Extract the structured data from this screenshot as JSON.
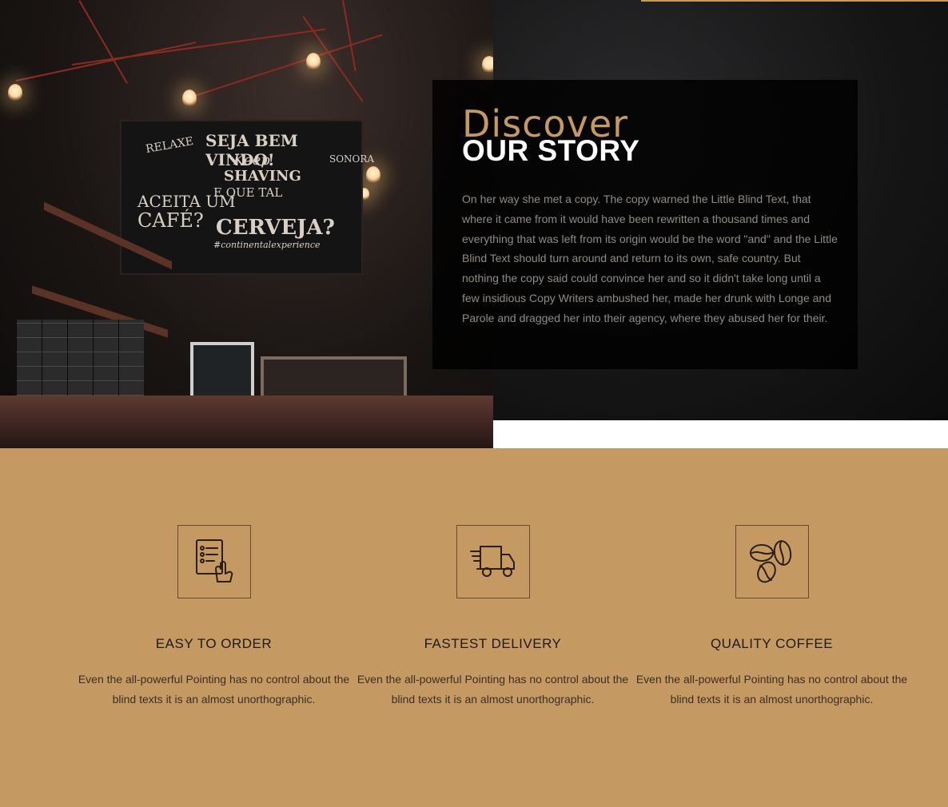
{
  "story": {
    "subheading": "Discover",
    "heading": "OUR STORY",
    "body": "On her way she met a copy. The copy warned the Little Blind Text, that where it came from it would have been rewritten a thousand times and everything that was left from its origin would be the word \"and\" and the Little Blind Text should turn around and return to its own, safe country. But nothing the copy said could convince her and so it didn't take long until a few insidious Copy Writers ambushed her, made her drunk with Longe and Parole and dragged her into their agency, where they abused her for their."
  },
  "features": [
    {
      "icon": "order-list-icon",
      "title": "EASY TO ORDER",
      "text": "Even the all-powerful Pointing has no control about the blind texts it is an almost unorthographic."
    },
    {
      "icon": "delivery-truck-icon",
      "title": "FASTEST DELIVERY",
      "text": "Even the all-powerful Pointing has no control about the blind texts it is an almost unorthographic."
    },
    {
      "icon": "coffee-beans-icon",
      "title": "QUALITY COFFEE",
      "text": "Even the all-powerful Pointing has no control about the blind texts it is an almost unorthographic."
    }
  ],
  "colors": {
    "accent": "#c49a62",
    "dark": "#151516",
    "text_muted": "#8f8a85"
  }
}
